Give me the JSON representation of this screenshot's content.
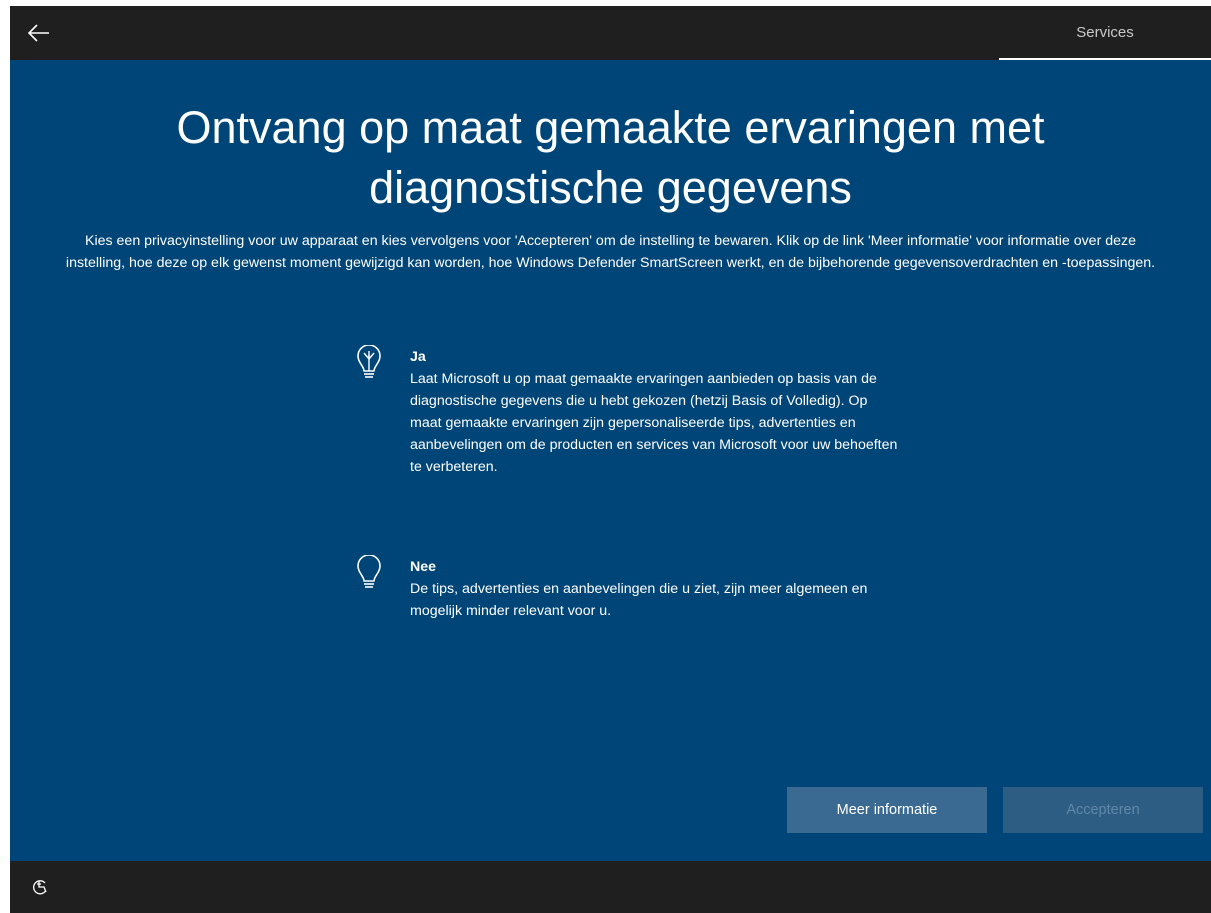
{
  "header": {
    "back_icon": "arrow-left-icon",
    "tab_label": "Services"
  },
  "main": {
    "title": "Ontvang op maat gemaakte ervaringen met diagnostische gegevens",
    "intro": "Kies een privacyinstelling voor uw apparaat en kies vervolgens voor 'Accepteren' om de instelling te bewaren. Klik op de link 'Meer informatie' voor informatie over deze instelling, hoe deze op elk gewenst moment gewijzigd kan worden, hoe Windows Defender SmartScreen werkt, en de bijbehorende gegevensoverdrachten en -toepassingen.",
    "options": [
      {
        "icon": "lightbulb-on-icon",
        "title": "Ja",
        "description": "Laat Microsoft u op maat gemaakte ervaringen aanbieden op basis van de diagnostische gegevens die u hebt gekozen (hetzij Basis of Volledig). Op maat gemaakte ervaringen zijn gepersonaliseerde tips, advertenties en aanbevelingen om de producten en services van Microsoft voor uw behoeften te verbeteren."
      },
      {
        "icon": "lightbulb-off-icon",
        "title": "Nee",
        "description": "De tips, advertenties en aanbevelingen die u ziet, zijn meer algemeen en mogelijk minder relevant voor u."
      }
    ]
  },
  "buttons": {
    "more_info": "Meer informatie",
    "accept": "Accepteren"
  },
  "footer": {
    "ease_of_access_icon": "ease-of-access-icon"
  },
  "colors": {
    "background_main": "#004577",
    "bar_dark": "#1f1f1f",
    "button_more": "#3a6a91",
    "button_accept_disabled": "#2d5d83",
    "text": "#ffffff"
  }
}
